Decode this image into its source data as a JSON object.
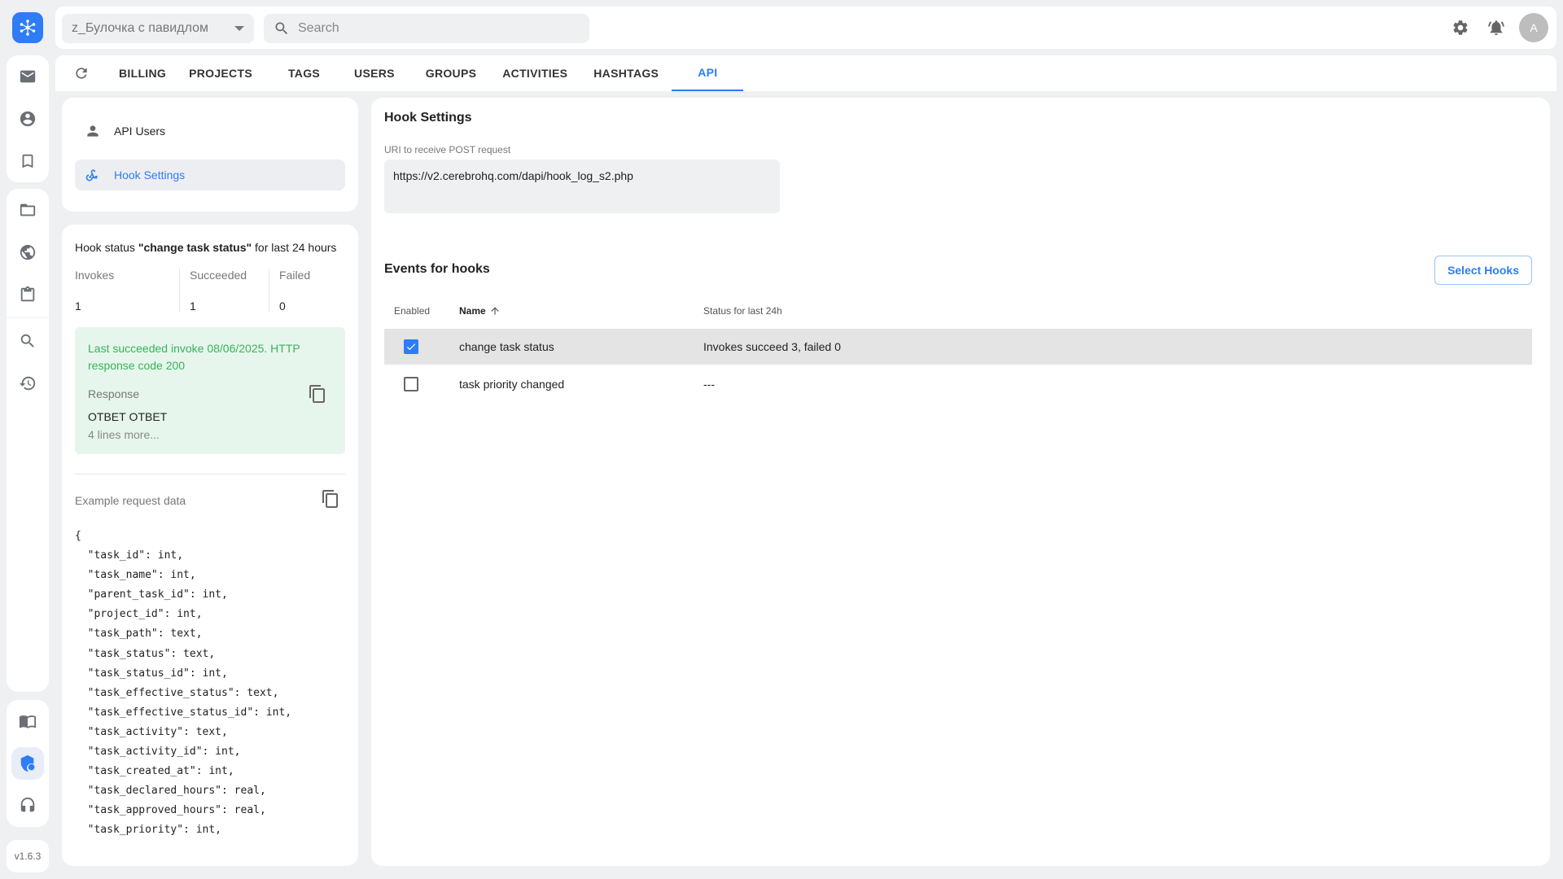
{
  "topbar": {
    "project": "z_Булочка с павидлом",
    "search_placeholder": "Search",
    "avatar_initial": "A"
  },
  "rail": {
    "version": "v1.6.3"
  },
  "tabs": {
    "items": [
      "BILLING",
      "PROJECTS",
      "TAGS",
      "USERS",
      "GROUPS",
      "ACTIVITIES",
      "HASHTAGS",
      "API"
    ],
    "active": "API"
  },
  "left_nav": {
    "items": [
      {
        "label": "API Users"
      },
      {
        "label": "Hook Settings"
      }
    ]
  },
  "hook_status": {
    "prefix": "Hook status ",
    "hook_name": "\"change task status\"",
    "suffix": " for last 24 hours",
    "invokes_label": "Invokes",
    "succeeded_label": "Succeeded",
    "failed_label": "Failed",
    "invokes": "1",
    "succeeded": "1",
    "failed": "0",
    "last_message": "Last succeeded invoke 08/06/2025. HTTP response code 200",
    "response_label": "Response",
    "response_value": "ОТВЕТ ОТВЕТ",
    "more": "4 lines more..."
  },
  "example": {
    "label": "Example request data",
    "code": "{\n  \"task_id\": int,\n  \"task_name\": int,\n  \"parent_task_id\": int,\n  \"project_id\": int,\n  \"task_path\": text,\n  \"task_status\": text,\n  \"task_status_id\": int,\n  \"task_effective_status\": text,\n  \"task_effective_status_id\": int,\n  \"task_activity\": text,\n  \"task_activity_id\": int,\n  \"task_created_at\": int,\n  \"task_declared_hours\": real,\n  \"task_approved_hours\": real,\n  \"task_priority\": int,"
  },
  "hook_settings": {
    "title": "Hook Settings",
    "uri_label": "URI to receive POST request",
    "uri_value": "https://v2.cerebrohq.com/dapi/hook_log_s2.php",
    "events_title": "Events for hooks",
    "select_hooks_label": "Select Hooks",
    "columns": {
      "enabled": "Enabled",
      "name": "Name",
      "status": "Status for last 24h"
    },
    "rows": [
      {
        "enabled": true,
        "name": "change task status",
        "status": "Invokes succeed 3, failed 0"
      },
      {
        "enabled": false,
        "name": "task priority changed",
        "status": "---"
      }
    ]
  }
}
